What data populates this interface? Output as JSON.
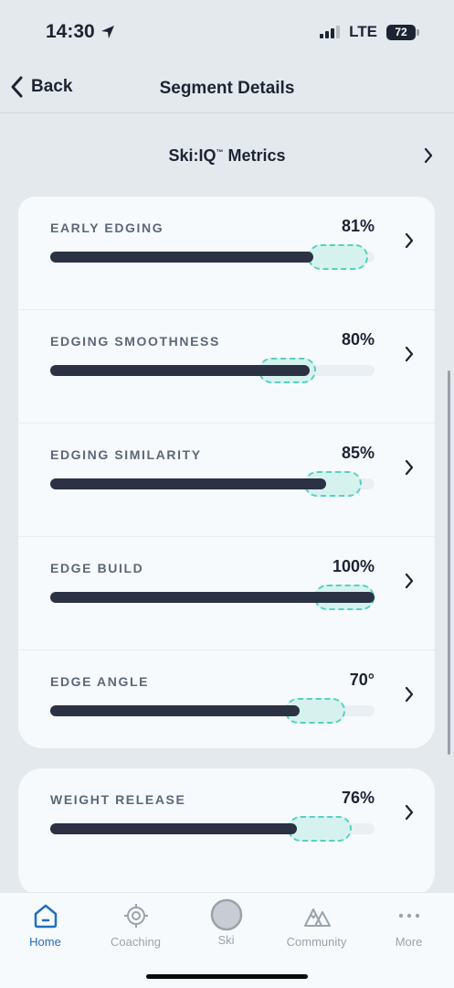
{
  "status_bar": {
    "time": "14:30",
    "network": "LTE",
    "battery": "72"
  },
  "nav": {
    "back_label": "Back",
    "title": "Segment Details"
  },
  "metrics_link": {
    "label": "Ski:IQ",
    "trademark": "™",
    "suffix": " Metrics"
  },
  "metrics": [
    {
      "name": "EARLY EDGING",
      "value": "81%",
      "progress": 0.81,
      "target": [
        0.81,
        0.98
      ]
    },
    {
      "name": "EDGING SMOOTHNESS",
      "value": "80%",
      "progress": 0.8,
      "target": [
        0.66,
        0.82
      ]
    },
    {
      "name": "EDGING SIMILARITY",
      "value": "85%",
      "progress": 0.85,
      "target": [
        0.8,
        0.96
      ]
    },
    {
      "name": "EDGE BUILD",
      "value": "100%",
      "progress": 1.0,
      "target": [
        0.83,
        1.0
      ]
    },
    {
      "name": "EDGE ANGLE",
      "value": "70°",
      "progress": 0.77,
      "target": [
        0.74,
        0.91
      ]
    },
    {
      "name": "WEIGHT RELEASE",
      "value": "76%",
      "progress": 0.76,
      "target": [
        0.75,
        0.93
      ]
    }
  ],
  "tabs": [
    {
      "label": "Home",
      "icon": "home-icon",
      "active": true
    },
    {
      "label": "Coaching",
      "icon": "target-icon",
      "active": false
    },
    {
      "label": "Ski",
      "icon": "ski-circle-icon",
      "active": false
    },
    {
      "label": "Community",
      "icon": "mountains-icon",
      "active": false
    },
    {
      "label": "More",
      "icon": "more-dots-icon",
      "active": false
    }
  ],
  "colors": {
    "accent": "#1f6fc1",
    "bar": "#2a3244",
    "target_fill": "#d6f2ef",
    "target_border": "#55d1c0"
  }
}
